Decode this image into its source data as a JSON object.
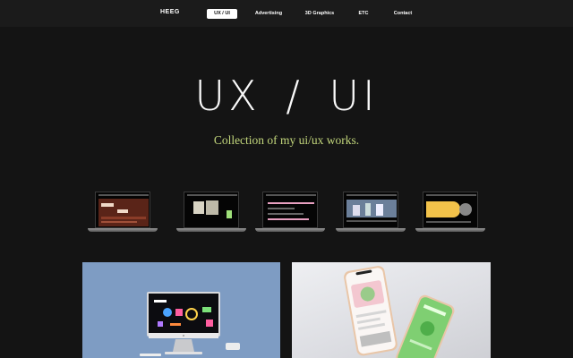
{
  "header": {
    "logo": "HEEG",
    "nav": [
      {
        "label": "UX / UI",
        "active": true
      },
      {
        "label": "Advertising",
        "active": false
      },
      {
        "label": "3D Graphics",
        "active": false
      },
      {
        "label": "ETC",
        "active": false
      },
      {
        "label": "Contact",
        "active": false
      }
    ]
  },
  "hero": {
    "title": "UX / UI",
    "subtitle": "Collection of my ui/ux works."
  },
  "colors": {
    "background": "#141414",
    "accent_subtitle": "#c3d77c",
    "card_blue": "#7e9cc3",
    "card_gray": "#e4e5e9"
  },
  "thumbnails": [
    {
      "name": "project-thumbnail-1"
    },
    {
      "name": "project-thumbnail-2"
    },
    {
      "name": "project-thumbnail-3"
    },
    {
      "name": "project-thumbnail-4"
    },
    {
      "name": "project-thumbnail-5"
    }
  ],
  "cards": [
    {
      "name": "imac-mockup-card"
    },
    {
      "name": "iphone-mockup-card"
    }
  ]
}
